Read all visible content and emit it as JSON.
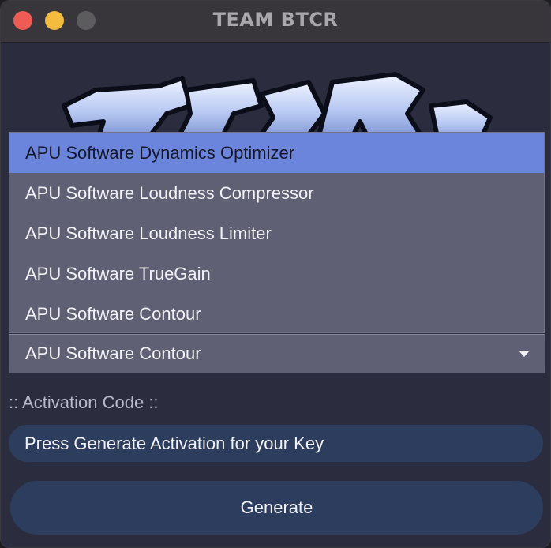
{
  "window": {
    "title": "TEAM BTCR"
  },
  "dropdown": {
    "options": [
      "APU Software Dynamics Optimizer",
      "APU Software Loudness Compressor",
      "APU Software Loudness Limiter",
      "APU Software TrueGain",
      "APU Software Contour"
    ],
    "highlighted_index": 0,
    "selected_value": "APU Software Contour"
  },
  "activation": {
    "label": ":: Activation Code ::",
    "value": "Press Generate Activation for your Key"
  },
  "buttons": {
    "generate_label": "Generate"
  },
  "icons": {
    "close": "close-traffic-light",
    "minimize": "minimize-traffic-light",
    "maximize": "maximize-traffic-light",
    "dropdown_arrow": "chevron-down-icon",
    "logo": "graffiti-logo"
  },
  "colors": {
    "accent_highlight": "#6b85dc",
    "window_bg": "#2b2d3e",
    "field_bg": "#2c3d5e",
    "dropdown_bg": "#5f6073"
  }
}
